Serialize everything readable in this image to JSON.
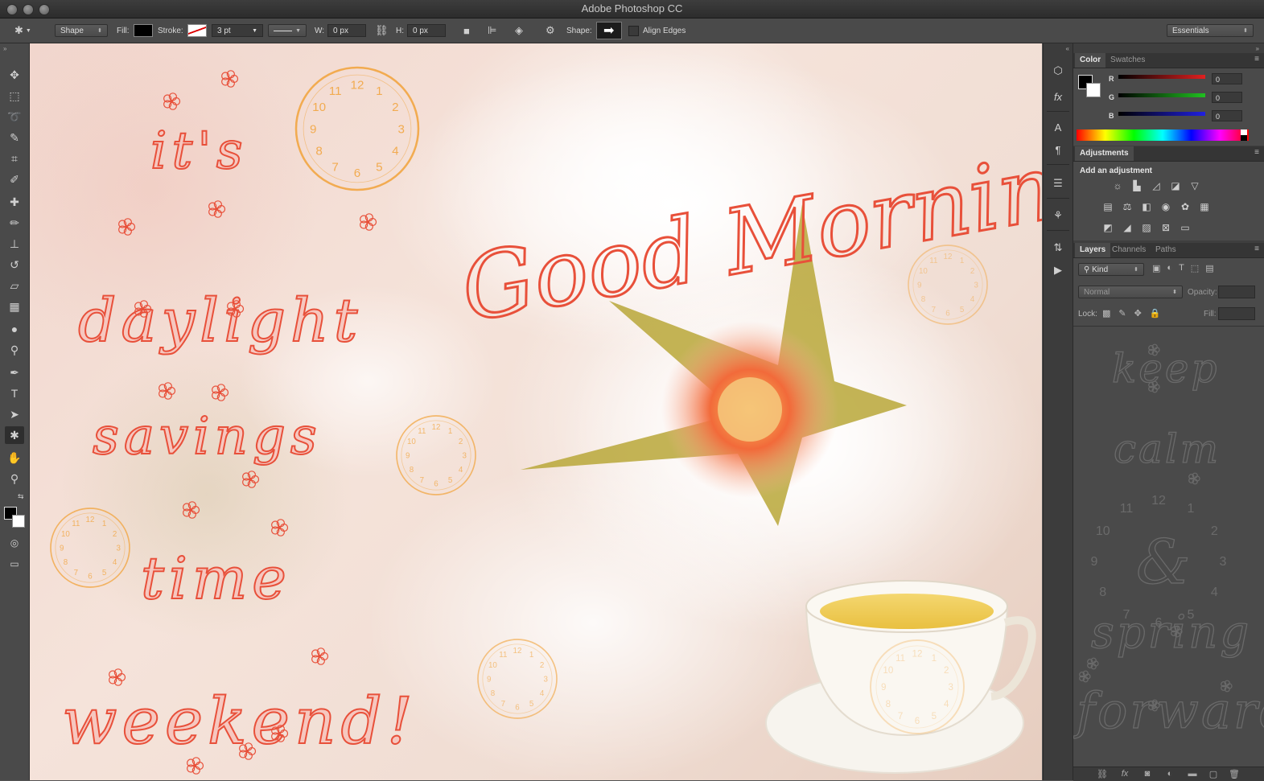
{
  "window": {
    "title": "Adobe Photoshop CC"
  },
  "options_bar": {
    "mode": "Shape",
    "fill_label": "Fill:",
    "stroke_label": "Stroke:",
    "stroke_width": "3 pt",
    "w_label": "W:",
    "w_value": "0 px",
    "h_label": "H:",
    "h_value": "0 px",
    "shape_label": "Shape:",
    "align_edges_label": "Align Edges",
    "workspace": "Essentials"
  },
  "tools": [
    {
      "name": "move-tool",
      "glyph": "✥"
    },
    {
      "name": "marquee-tool",
      "glyph": "⬚"
    },
    {
      "name": "lasso-tool",
      "glyph": "➰"
    },
    {
      "name": "quick-selection-tool",
      "glyph": "✎"
    },
    {
      "name": "crop-tool",
      "glyph": "⌗"
    },
    {
      "name": "eyedropper-tool",
      "glyph": "✐"
    },
    {
      "name": "healing-brush-tool",
      "glyph": "✚"
    },
    {
      "name": "brush-tool",
      "glyph": "✏"
    },
    {
      "name": "clone-stamp-tool",
      "glyph": "⊥"
    },
    {
      "name": "history-brush-tool",
      "glyph": "↺"
    },
    {
      "name": "eraser-tool",
      "glyph": "▱"
    },
    {
      "name": "gradient-tool",
      "glyph": "▦"
    },
    {
      "name": "blur-tool",
      "glyph": "●"
    },
    {
      "name": "dodge-tool",
      "glyph": "⚲"
    },
    {
      "name": "pen-tool",
      "glyph": "✒"
    },
    {
      "name": "type-tool",
      "glyph": "T"
    },
    {
      "name": "path-selection-tool",
      "glyph": "➤"
    },
    {
      "name": "custom-shape-tool",
      "glyph": "✱"
    },
    {
      "name": "hand-tool",
      "glyph": "✋"
    },
    {
      "name": "zoom-tool",
      "glyph": "⚲"
    }
  ],
  "color_panel": {
    "tabs": [
      "Color",
      "Swatches"
    ],
    "channels": [
      {
        "label": "R",
        "value": "0",
        "color": "#e02020"
      },
      {
        "label": "G",
        "value": "0",
        "color": "#20c020"
      },
      {
        "label": "B",
        "value": "0",
        "color": "#2020e0"
      }
    ]
  },
  "adjustments_panel": {
    "tab": "Adjustments",
    "heading": "Add an adjustment"
  },
  "layers_panel": {
    "tabs": [
      "Layers",
      "Channels",
      "Paths"
    ],
    "filter_kind": "Kind",
    "blend_mode": "Normal",
    "opacity_label": "Opacity:",
    "lock_label": "Lock:",
    "fill_label": "Fill:"
  },
  "artwork": {
    "left_words": [
      "it's",
      "daylight",
      "savings",
      "time",
      "weekend!"
    ],
    "headline": "Good Morning!",
    "ghost_words": [
      "keep",
      "calm",
      "&",
      "spring",
      "forward"
    ],
    "clock_numerals": [
      "12",
      "1",
      "2",
      "3",
      "4",
      "5",
      "6",
      "7",
      "8",
      "9",
      "10",
      "11"
    ],
    "ink_color": "#e8503a",
    "clock_color": "#f2a33a"
  }
}
